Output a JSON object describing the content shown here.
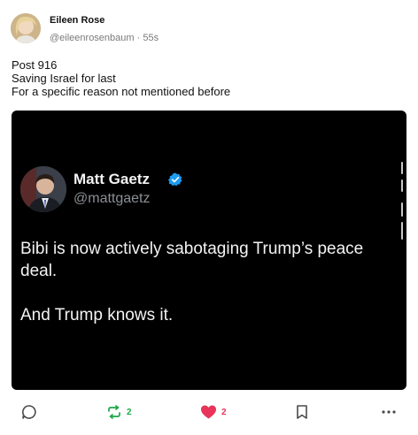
{
  "author": {
    "name": "Eileen Rose",
    "handle": "@eileenrosenbaum",
    "time": "55s"
  },
  "body": {
    "lines": [
      "Post 916",
      "Saving Israel for last",
      "For a specific reason not mentioned before"
    ]
  },
  "embed": {
    "name": "Matt Gaetz",
    "handle": "@mattgaetz",
    "paragraphs": [
      "Bibi is now actively sabotaging Trump’s peace deal.",
      "And Trump knows it."
    ]
  },
  "actions": {
    "reply": {
      "icon": "reply-icon"
    },
    "repost": {
      "icon": "repost-icon",
      "count": "2",
      "color": "#1fa84a"
    },
    "like": {
      "icon": "heart-icon",
      "count": "2",
      "color": "#e8345a"
    },
    "bookmark": {
      "icon": "bookmark-icon"
    },
    "more": {
      "icon": "more-icon"
    }
  }
}
